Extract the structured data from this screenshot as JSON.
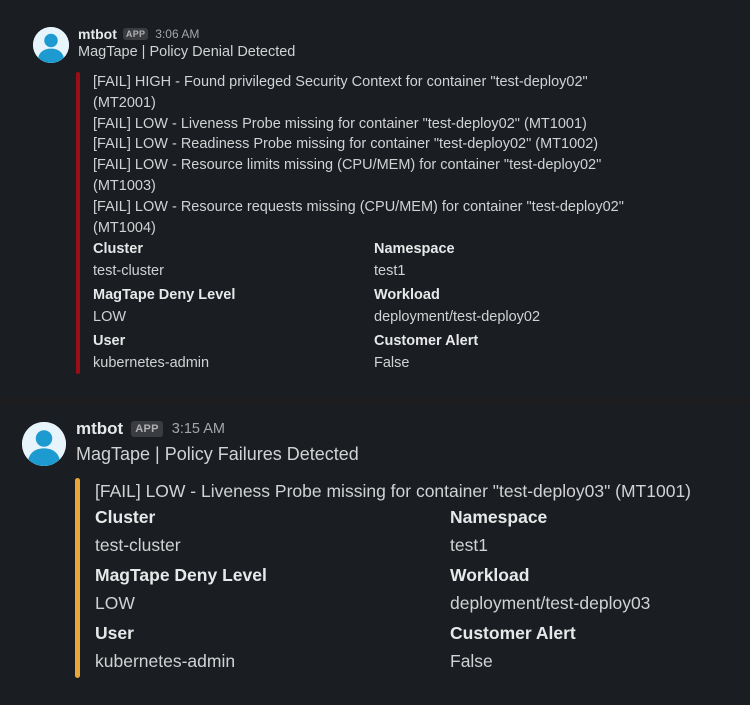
{
  "messages": [
    {
      "sender": "mtbot",
      "badge": "APP",
      "time": "3:06 AM",
      "title": "MagTape | Policy Denial Detected",
      "bar_color": "#9b0e15",
      "attachment": {
        "lines": [
          "[FAIL] HIGH - Found privileged Security Context for container \"test-deploy02\" (MT2001)",
          "[FAIL] LOW - Liveness Probe missing for container \"test-deploy02\" (MT1001)",
          "[FAIL] LOW - Readiness Probe missing for container \"test-deploy02\" (MT1002)",
          "[FAIL] LOW - Resource limits missing (CPU/MEM) for container \"test-deploy02\" (MT1003)",
          "[FAIL] LOW - Resource requests missing (CPU/MEM) for container \"test-deploy02\" (MT1004)"
        ],
        "fields": [
          {
            "label": "Cluster",
            "value": "test-cluster"
          },
          {
            "label": "Namespace",
            "value": "test1"
          },
          {
            "label": "MagTape Deny Level",
            "value": "LOW"
          },
          {
            "label": "Workload",
            "value": "deployment/test-deploy02"
          },
          {
            "label": "User",
            "value": "kubernetes-admin"
          },
          {
            "label": "Customer Alert",
            "value": "False"
          }
        ]
      }
    },
    {
      "sender": "mtbot",
      "badge": "APP",
      "time": "3:15 AM",
      "title": "MagTape | Policy Failures Detected",
      "bar_color": "#e8a73a",
      "attachment": {
        "lines": [
          "[FAIL] LOW - Liveness Probe missing for container \"test-deploy03\" (MT1001)"
        ],
        "fields": [
          {
            "label": "Cluster",
            "value": "test-cluster"
          },
          {
            "label": "Namespace",
            "value": "test1"
          },
          {
            "label": "MagTape Deny Level",
            "value": "LOW"
          },
          {
            "label": "Workload",
            "value": "deployment/test-deploy03"
          },
          {
            "label": "User",
            "value": "kubernetes-admin"
          },
          {
            "label": "Customer Alert",
            "value": "False"
          }
        ]
      }
    }
  ]
}
